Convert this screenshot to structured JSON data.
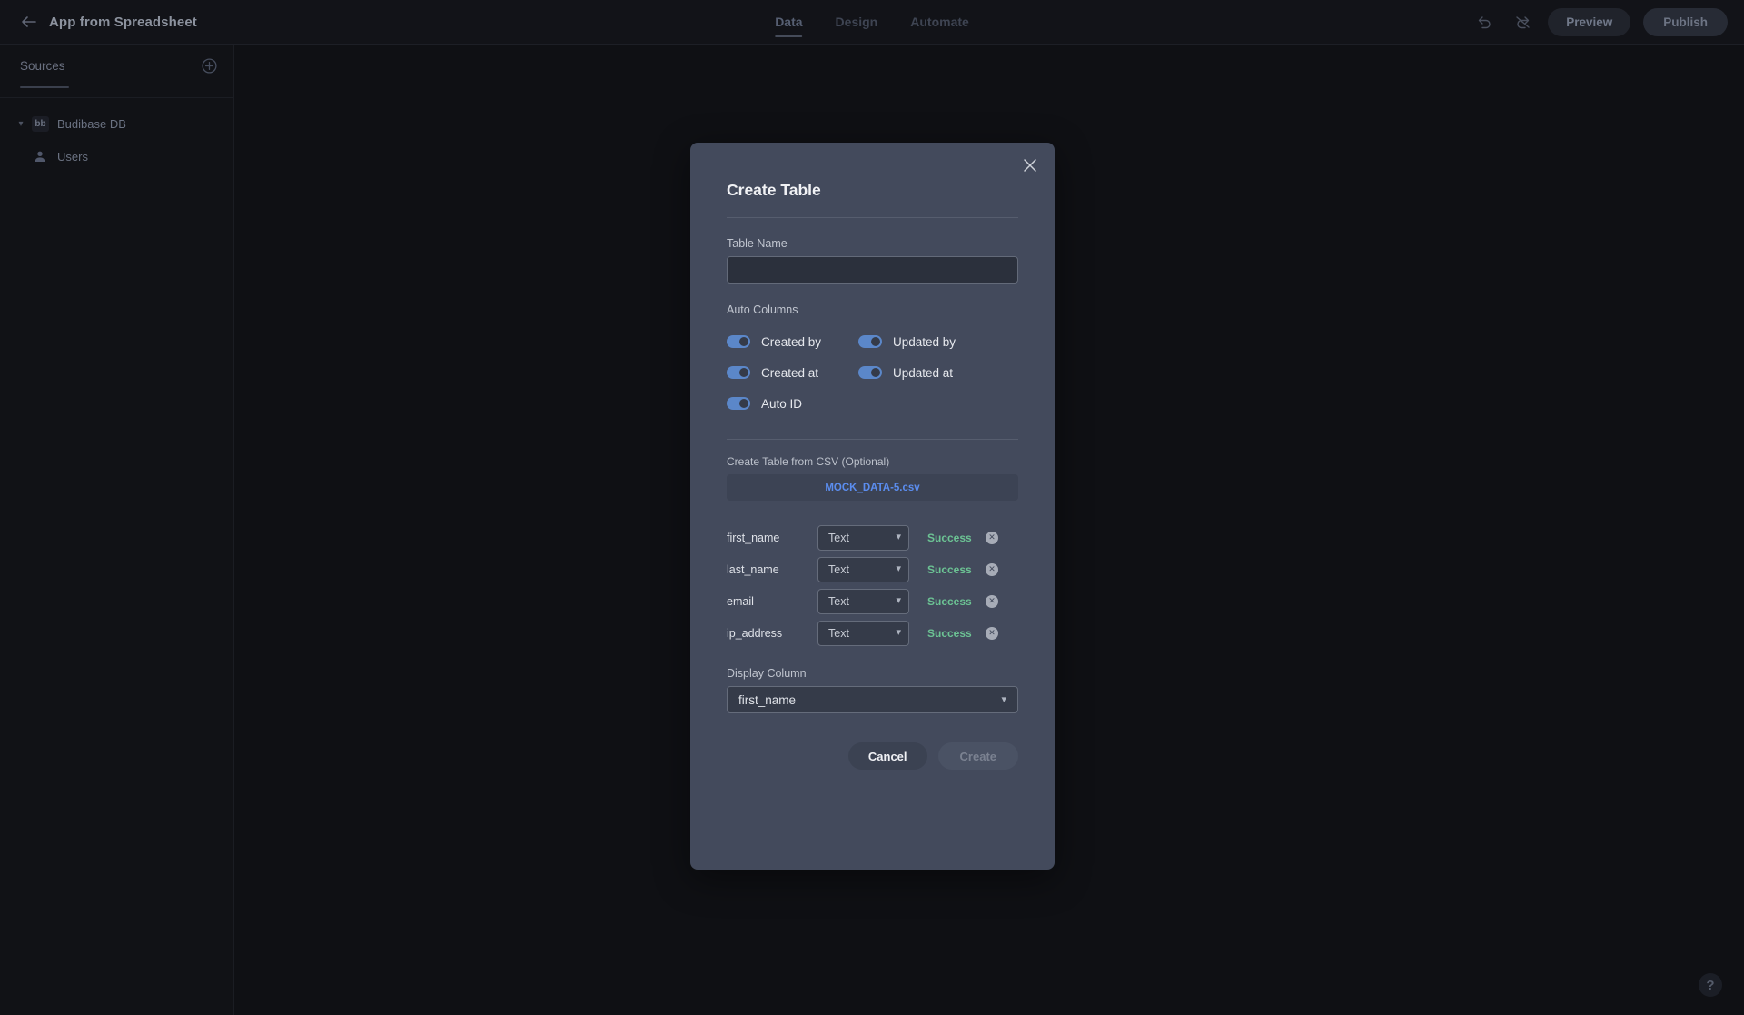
{
  "topbar": {
    "back_icon": "back-arrow-icon",
    "app_title": "App from Spreadsheet",
    "tabs": [
      {
        "label": "Data",
        "active": true
      },
      {
        "label": "Design",
        "active": false
      },
      {
        "label": "Automate",
        "active": false
      }
    ],
    "undo_icon": "undo-icon",
    "redo_icon": "redo-icon",
    "preview_label": "Preview",
    "publish_label": "Publish"
  },
  "sidebar": {
    "title": "Sources",
    "add_icon": "plus-circle-icon",
    "items": [
      {
        "label": "Budibase DB",
        "icon": "budibase-db-icon",
        "badge": "bb"
      },
      {
        "label": "Users",
        "icon": "users-icon"
      }
    ]
  },
  "modal": {
    "title": "Create Table",
    "close_icon": "close-icon",
    "table_name": {
      "label": "Table Name",
      "value": "",
      "placeholder": ""
    },
    "auto_columns": {
      "label": "Auto Columns",
      "toggles": [
        {
          "label": "Created by",
          "on": true
        },
        {
          "label": "Updated by",
          "on": true
        },
        {
          "label": "Created at",
          "on": true
        },
        {
          "label": "Updated at",
          "on": true
        },
        {
          "label": "Auto ID",
          "on": true
        }
      ]
    },
    "csv": {
      "label": "Create Table from CSV (Optional)",
      "file_name": "MOCK_DATA-5.csv"
    },
    "columns": [
      {
        "name": "first_name",
        "type": "Text",
        "status": "Success",
        "remove_icon": "remove-circle-icon"
      },
      {
        "name": "last_name",
        "type": "Text",
        "status": "Success",
        "remove_icon": "remove-circle-icon"
      },
      {
        "name": "email",
        "type": "Text",
        "status": "Success",
        "remove_icon": "remove-circle-icon"
      },
      {
        "name": "ip_address",
        "type": "Text",
        "status": "Success",
        "remove_icon": "remove-circle-icon"
      }
    ],
    "display_column": {
      "label": "Display Column",
      "value": "first_name"
    },
    "cancel_label": "Cancel",
    "create_label": "Create"
  },
  "help": {
    "icon": "help-question-icon",
    "label": "?"
  },
  "colors": {
    "page_bg": "#0f1014",
    "modal_bg": "#434a5c",
    "accent_blue": "#5b8def",
    "toggle_on": "#5b87c9",
    "success_green": "#6cc394"
  }
}
